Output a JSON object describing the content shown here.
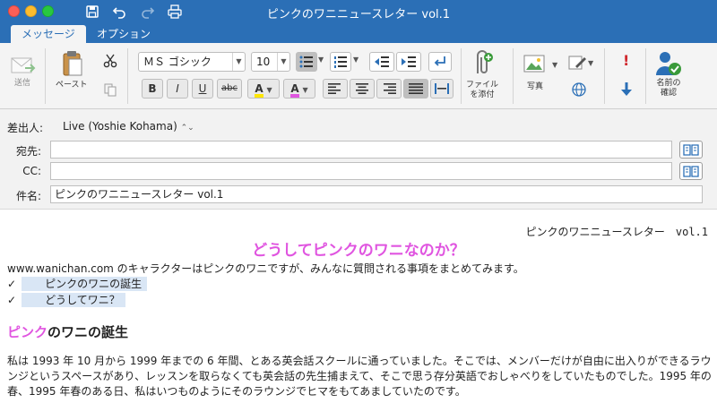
{
  "window": {
    "title": "ピンクのワニニュースレター vol.1"
  },
  "tabs": [
    {
      "label": "メッセージ"
    },
    {
      "label": "オプション"
    }
  ],
  "ribbon": {
    "send_label": "送信",
    "paste_label": "ペースト",
    "font_name": "ＭＳ ゴシック",
    "font_size": "10",
    "bold": "B",
    "italic": "I",
    "underline": "U",
    "strike": "abc",
    "highlight_glyph": "A",
    "fontcolor_glyph": "A",
    "attach_label": "ファイル\nを添付",
    "attach_line1": "ファイル",
    "attach_line2": "を添付",
    "picture_label": "写真",
    "names_line1": "名前の",
    "names_line2": "確認",
    "high_importance": "!"
  },
  "header": {
    "from_label": "差出人:",
    "from_value": "Live (Yoshie Kohama)",
    "to_label": "宛先:",
    "to_value": "",
    "cc_label": "CC:",
    "cc_value": "",
    "subject_label": "件名:",
    "subject_value": "ピンクのワニニュースレター vol.1"
  },
  "body": {
    "top_right": "ピンクのワニニュースレター　vol.1",
    "main_heading": "どうしてピンクのワニなのか？",
    "intro": "www.wanichan.com のキャラクターはピンクのワニですが、みんなに質問される事項をまとめてみます。",
    "checks": [
      "ピンクのワニの誕生",
      "どうしてワニ？"
    ],
    "check_glyph": "✓",
    "section_pink": "ピンク",
    "section_rest": "のワニの誕生",
    "para1": "私は 1993 年 10 月から 1999 年までの 6 年間、とある英会話スクールに通っていました。そこでは、メンバーだけが自由に出入りができるラウンジというスペースがあり、レッスンを取らなくても英会話の先生捕まえて、そこで思う存分英語でおしゃべりをしていたものでした。1995 年の春、1995 年春のある日、私はいつものようにそのラウンジでヒマをもてあましていたのです。"
  },
  "colors": {
    "brand_blue": "#2b6fb6",
    "accent_pink": "#e055e0",
    "highlight": "#d9e6f5"
  }
}
